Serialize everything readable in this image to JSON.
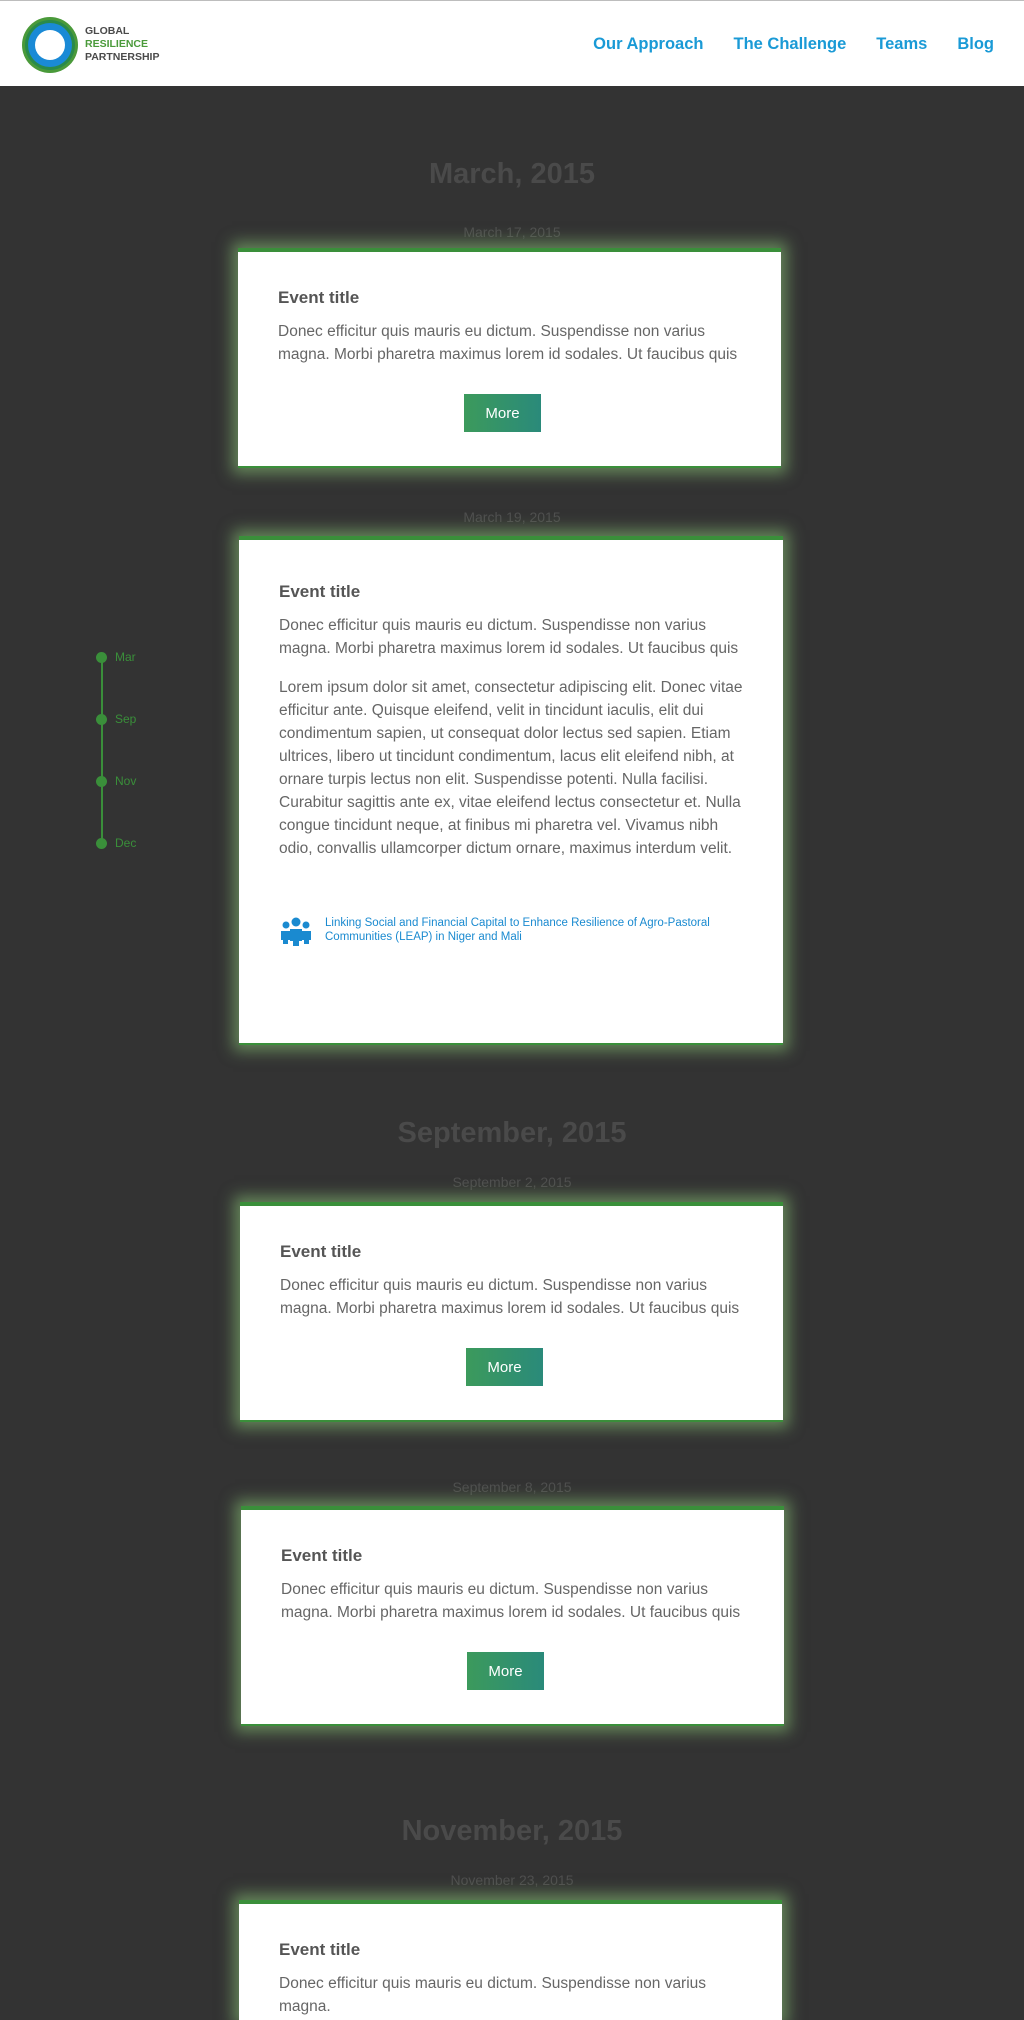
{
  "brand": {
    "line1": "GLOBAL",
    "line2": "RESILIENCE",
    "line3": "PARTNERSHIP",
    "accent_blue": "#1a9ad6",
    "accent_green": "#3a8f3a"
  },
  "nav": {
    "items": [
      {
        "label": "Our Approach"
      },
      {
        "label": "The Challenge"
      },
      {
        "label": "Teams"
      },
      {
        "label": "Blog"
      }
    ]
  },
  "timeline": {
    "items": [
      {
        "label": "Mar"
      },
      {
        "label": "Sep"
      },
      {
        "label": "Nov"
      },
      {
        "label": "Dec"
      }
    ]
  },
  "months": [
    {
      "title": "March, 2015"
    },
    {
      "title": "September, 2015"
    },
    {
      "title": "November, 2015"
    }
  ],
  "events": [
    {
      "date": "March 17, 2015",
      "title": "Event title",
      "summary": "Donec efficitur quis mauris eu dictum. Suspendisse non varius magna. Morbi pharetra maximus lorem id sodales. Ut faucibus quis",
      "more_label": "More"
    },
    {
      "date": "March 19, 2015",
      "title": "Event title",
      "summary": "Donec efficitur quis mauris eu dictum. Suspendisse non varius magna. Morbi pharetra maximus lorem id sodales. Ut faucibus quis",
      "body": "Lorem ipsum dolor sit amet, consectetur adipiscing elit. Donec vitae efficitur ante. Quisque eleifend, velit in tincidunt iaculis, elit dui condimentum sapien, ut consequat dolor lectus sed sapien. Etiam ultrices, libero ut tincidunt condimentum, lacus elit eleifend nibh, at ornare turpis lectus non elit. Suspendisse potenti. Nulla facilisi. Curabitur sagittis ante ex, vitae eleifend lectus consectetur et. Nulla congue tincidunt neque, at finibus mi pharetra vel. Vivamus nibh odio, convallis ullamcorper dictum ornare, maximus interdum velit.",
      "project_link": "Linking Social and Financial Capital to Enhance Resilience of Agro-Pastoral Communities (LEAP) in Niger and Mali",
      "project_icon": "people-group-icon"
    },
    {
      "date": "September 2, 2015",
      "title": "Event title",
      "summary": "Donec efficitur quis mauris eu dictum. Suspendisse non varius magna. Morbi pharetra maximus lorem id sodales. Ut faucibus quis",
      "more_label": "More"
    },
    {
      "date": "September 8, 2015",
      "title": "Event title",
      "summary": "Donec efficitur quis mauris eu dictum. Suspendisse non varius magna. Morbi pharetra maximus lorem id sodales. Ut faucibus quis",
      "more_label": "More"
    },
    {
      "date": "November 23, 2015",
      "title": "Event title",
      "summary": "Donec efficitur quis mauris eu dictum. Suspendisse non varius magna."
    }
  ]
}
